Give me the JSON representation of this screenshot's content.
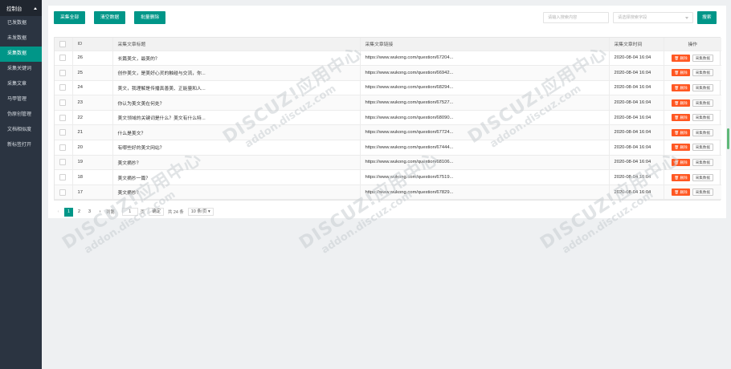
{
  "sidebar": {
    "title": "控制台",
    "items": [
      {
        "label": "已发数据",
        "active": false
      },
      {
        "label": "未发数据",
        "active": false
      },
      {
        "label": "采集数据",
        "active": true
      },
      {
        "label": "采集关键词",
        "active": false
      },
      {
        "label": "采集文章",
        "active": false
      },
      {
        "label": "马甲管理",
        "active": false
      },
      {
        "label": "伪原创管理",
        "active": false
      },
      {
        "label": "文档相似度",
        "active": false
      },
      {
        "label": "新标签打开",
        "active": false
      }
    ]
  },
  "toolbar": {
    "collect_all": "采集全部",
    "clear_data": "清空数据",
    "batch_delete": "批量删除",
    "search_placeholder": "请输入搜索内容",
    "field_placeholder": "请选择搜索字段",
    "search_button": "搜索"
  },
  "table": {
    "headers": [
      "ID",
      "采集文章标题",
      "采集文章链接",
      "采集文章时间",
      "操作"
    ],
    "delete_label": "删除",
    "collect_label": "采集数据",
    "rows": [
      {
        "id": "26",
        "title": "长篇美文，最美的？",
        "link": "https://www.wukong.com/question/67204...",
        "time": "2020-08-04 16:04"
      },
      {
        "id": "25",
        "title": "创作美文，是美好心灵的触碰与交流，你...",
        "link": "https://www.wukong.com/question/66942...",
        "time": "2020-08-04 16:04"
      },
      {
        "id": "24",
        "title": "美文，我理解是传播真善美、正能量和人...",
        "link": "https://www.wukong.com/question/68294...",
        "time": "2020-08-04 16:04"
      },
      {
        "id": "23",
        "title": "你认为美文美在何处？",
        "link": "https://www.wukong.com/question/67527...",
        "time": "2020-08-04 16:04"
      },
      {
        "id": "22",
        "title": "美文领域的关键词是什么？美文有什么特...",
        "link": "https://www.wukong.com/question/68090...",
        "time": "2020-08-04 16:04"
      },
      {
        "id": "21",
        "title": "什么是美文？",
        "link": "https://www.wukong.com/question/67724...",
        "time": "2020-08-04 16:04"
      },
      {
        "id": "20",
        "title": "有哪些好的美文网站？",
        "link": "https://www.wukong.com/question/67444...",
        "time": "2020-08-04 16:04"
      },
      {
        "id": "19",
        "title": "美文摘抄？",
        "link": "https://www.wukong.com/question/68106...",
        "time": "2020-08-04 16:04"
      },
      {
        "id": "18",
        "title": "美文摘抄一篇？",
        "link": "https://www.wukong.com/question/67519...",
        "time": "2020-08-04 16:04"
      },
      {
        "id": "17",
        "title": "美文摘抄？",
        "link": "https://www.wukong.com/question/67829...",
        "time": "2020-08-04 16:04"
      }
    ]
  },
  "pager": {
    "pages": [
      "1",
      "2",
      "3"
    ],
    "goto_label": "到第",
    "goto_value": "1",
    "page_unit": "页",
    "confirm": "确定",
    "total": "共 24 条",
    "page_size": "10 条/页"
  },
  "watermark": {
    "brand": "DISCUZ!应用中心",
    "domain": "addon.discuz.com"
  },
  "colors": {
    "accent": "#009688",
    "danger": "#ff5722",
    "sidebar_bg": "#2b3441"
  }
}
